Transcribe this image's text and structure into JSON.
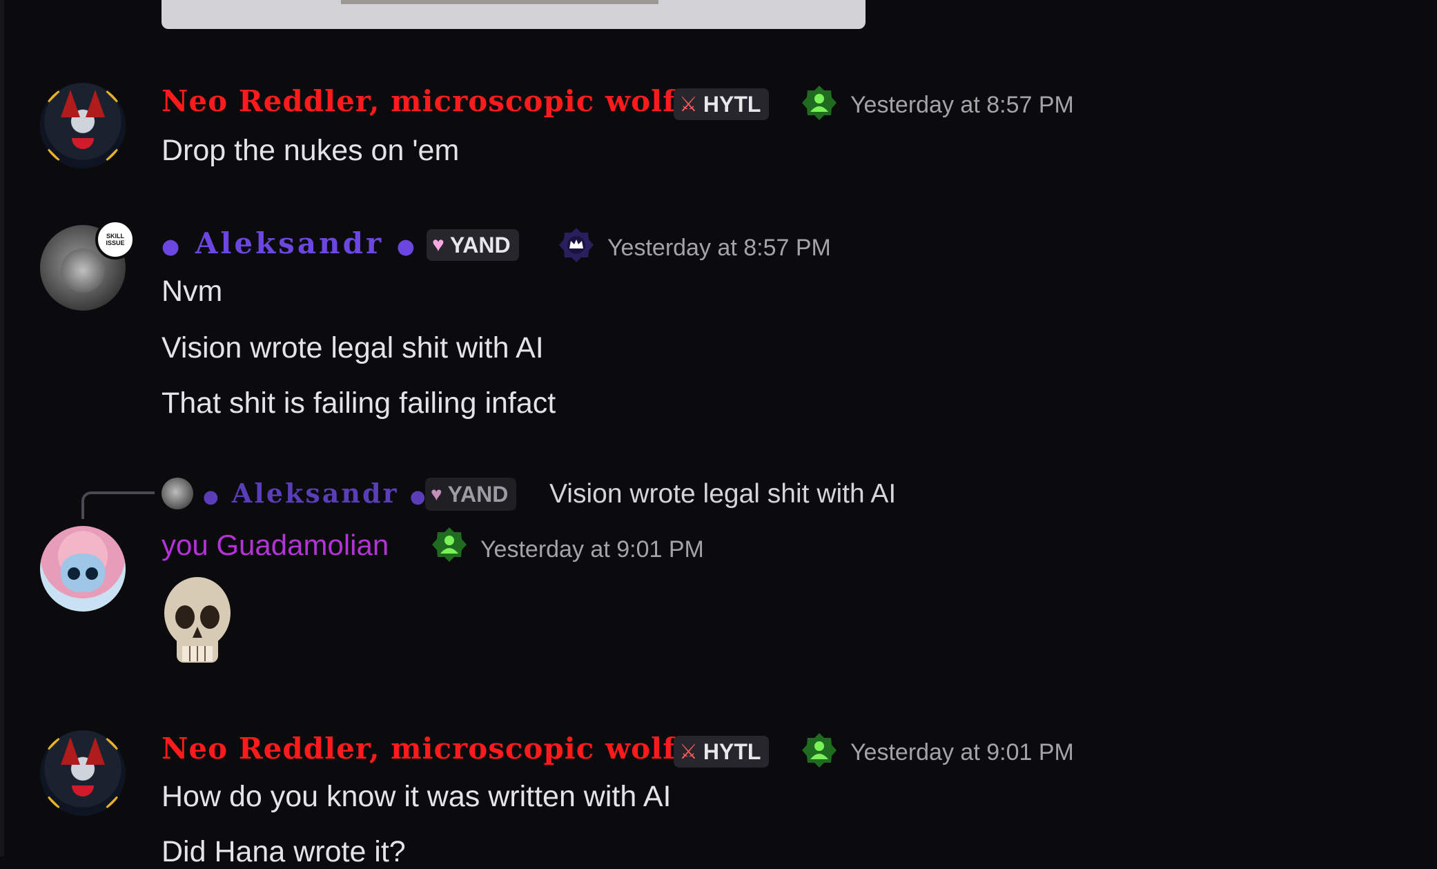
{
  "messages": [
    {
      "author": "Neo Reddler, microscopic wolf",
      "tag": "HYTL",
      "tag_icon": "sword-icon",
      "role_icon": "green-person-icon",
      "timestamp": "Yesterday at 8:57 PM",
      "lines": [
        "Drop the nukes on 'em"
      ]
    },
    {
      "author": "Aleksandr",
      "avatar_badge": "SKILL ISSUE",
      "tag": "YAND",
      "tag_icon": "heart-icon",
      "role_icon": "crown-icon",
      "timestamp": "Yesterday at 8:57 PM",
      "lines": [
        "Nvm",
        "Vision wrote legal shit with AI",
        "That shit is failing failing infact"
      ]
    },
    {
      "reply": {
        "author": "Aleksandr",
        "tag": "YAND",
        "text": "Vision wrote legal shit with AI"
      },
      "author": "you Guadamolian",
      "role_icon": "green-person-icon",
      "timestamp": "Yesterday at 9:01 PM",
      "emoji": "skull"
    },
    {
      "author": "Neo Reddler, microscopic wolf",
      "tag": "HYTL",
      "tag_icon": "sword-icon",
      "role_icon": "green-person-icon",
      "timestamp": "Yesterday at 9:01 PM",
      "lines": [
        "How do you know it was written with AI",
        "Did Hana wrote it?"
      ]
    }
  ],
  "colors": {
    "background": "#0b0b0e",
    "neo_name": "#ff1b1b",
    "aleksandr_name": "#6b46e0",
    "guadamolian_name": "#b532d8",
    "tag_bg": "#26262c",
    "timestamp": "#a3a4aa"
  }
}
